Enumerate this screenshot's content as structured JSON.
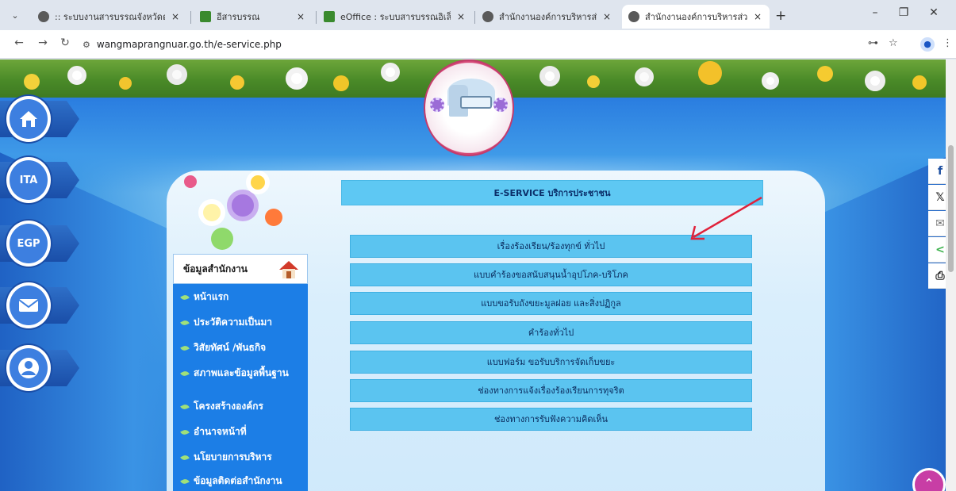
{
  "browser": {
    "tabs": [
      {
        "title": ":: ระบบงานสารบรรณจังหวัดตรัง",
        "close": "×"
      },
      {
        "title": "อีสารบรรณ",
        "close": "×"
      },
      {
        "title": "eOffice : ระบบสารบรรณอิเล็กทรอนิ",
        "close": "×"
      },
      {
        "title": "สำนักงานองค์การบริหารส่วนตำบลวัง",
        "close": "×"
      },
      {
        "title": "สำนักงานองค์การบริหารส่วนตำบลวัง",
        "close": "×"
      }
    ],
    "new_tab": "+",
    "url": "wangmaprangnuar.go.th/e-service.php"
  },
  "side_buttons": [
    {
      "name": "home-icon",
      "label": ""
    },
    {
      "name": "ita-icon",
      "label": "ITA"
    },
    {
      "name": "egp-icon",
      "label": "EGP"
    },
    {
      "name": "email-icon",
      "label": ""
    },
    {
      "name": "user-icon",
      "label": ""
    }
  ],
  "sidebar": {
    "header": "ข้อมูลสำนักงาน",
    "items": [
      "หน้าแรก",
      "ประวัติความเป็นมา",
      "วิสัยทัศน์ /พันธกิจ",
      "สภาพและข้อมูลพื้นฐาน",
      "โครงสร้างองค์กร",
      "อำนาจหน้าที่",
      "นโยบายการบริหาร",
      "ข้อมูลติดต่อสำนักงาน"
    ]
  },
  "eservice": {
    "title": "E-SERVICE บริการประชาชน",
    "buttons": [
      "เรื่องร้องเรียน/ร้องทุกข์ ทั่วไป",
      "แบบคำร้องขอสนับสนุนน้ำอุปโภค-บริโภค",
      "แบบขอรับถังขยะมูลฝอย และสิ่งปฏิกูล",
      "คำร้องทั่วไป",
      "แบบฟอร์ม ขอรับบริการจัดเก็บขยะ",
      "ช่องทางการแจ้งเรื่องร้องเรียนการทุจริต",
      "ช่องทางการรับฟังความคิดเห็น"
    ]
  },
  "share": [
    {
      "name": "facebook-icon",
      "glyph": "f"
    },
    {
      "name": "x-icon",
      "glyph": "𝕏"
    },
    {
      "name": "mail-icon",
      "glyph": "✉"
    },
    {
      "name": "share-icon",
      "glyph": "<"
    },
    {
      "name": "print-icon",
      "glyph": "⎙"
    }
  ],
  "colors": {
    "menu_bg": "#1c7ee6",
    "service_button": "#5bc4f0",
    "arrow": "#e0213a"
  }
}
